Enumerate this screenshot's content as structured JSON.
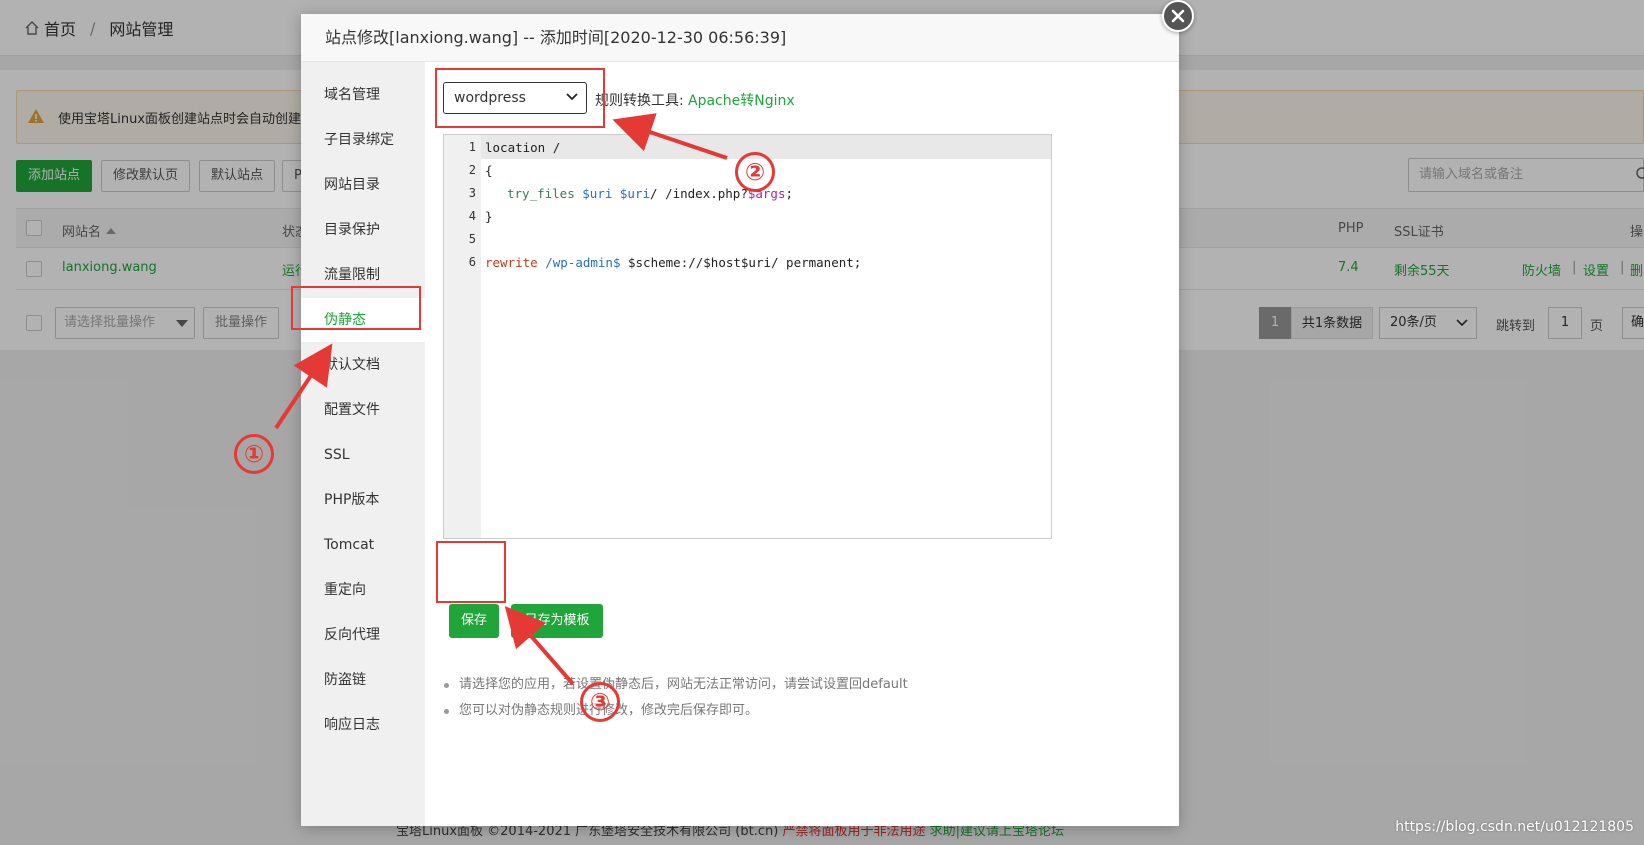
{
  "background": {
    "breadcrumb": {
      "home": "首页",
      "separator": "/",
      "current": "网站管理"
    },
    "alert_text": "使用宝塔Linux面板创建站点时会自动创建",
    "toolbar": {
      "add_site": "添加站点",
      "edit_default_page": "修改默认页",
      "default_site": "默认站点",
      "php_cli": "P"
    },
    "search_placeholder": "请输入域名或备注",
    "table": {
      "headers": {
        "name": "网站名",
        "status": "状态",
        "php": "PHP",
        "ssl": "SSL证书",
        "ops": "操"
      },
      "row": {
        "name": "lanxiong.wang",
        "status": "运行",
        "php": "7.4",
        "ssl": "剩余55天",
        "firewall": "防火墙",
        "settings": "设置",
        "delete": "删",
        "sep": "|"
      }
    },
    "batch": {
      "select": "请选择批量操作",
      "button": "批量操作"
    },
    "pager": {
      "current": "1",
      "total": "共1条数据",
      "pagesize": "20条/页",
      "jump_label": "跳转到",
      "jump_value": "1",
      "page_unit": "页",
      "confirm": "确"
    },
    "footer": {
      "copyright": "宝塔Linux面板 ©2014-2021 广东堡塔安全技术有限公司 (bt.cn)",
      "warning": "严禁将面板用于非法用途",
      "help": "求助|建议请上宝塔论坛"
    }
  },
  "dialog": {
    "title": "站点修改[lanxiong.wang] -- 添加时间[2020-12-30 06:56:39]",
    "menu": [
      "域名管理",
      "子目录绑定",
      "网站目录",
      "目录保护",
      "流量限制",
      "伪静态",
      "默认文档",
      "配置文件",
      "SSL",
      "PHP版本",
      "Tomcat",
      "重定向",
      "反向代理",
      "防盗链",
      "响应日志"
    ],
    "active_menu": "伪静态",
    "preset_select": "wordpress",
    "tool_label": "规则转换工具:",
    "tool_link": "Apache转Nginx",
    "editor": {
      "line_numbers": [
        "1",
        "2",
        "3",
        "4",
        "5",
        "6"
      ],
      "lines": {
        "l1": "location /",
        "l2": "{",
        "l3_kw": "try_files",
        "l3_v1": "$uri",
        "l3_v2": "$uri",
        "l3_mid": "/ /index.php?",
        "l3_v3": "$args",
        "l3_end": ";",
        "l4": "}",
        "l6_kw": "rewrite",
        "l6_re": "/wp-admin$",
        "l6_rest": " $scheme://$host$uri/ permanent;"
      }
    },
    "save_button": "保存",
    "save_template_button": "另存为模板",
    "tips": [
      "请选择您的应用，若设置伪静态后，网站无法正常访问，请尝试设置回default",
      "您可以对伪静态规则进行修改，修改完后保存即可。"
    ]
  },
  "annotations": {
    "step1": "①",
    "step2": "②",
    "step3": "③"
  },
  "watermark": "https://blog.csdn.net/u012121805",
  "colors": {
    "accent": "#20a53a",
    "annotation": "#e53935"
  }
}
